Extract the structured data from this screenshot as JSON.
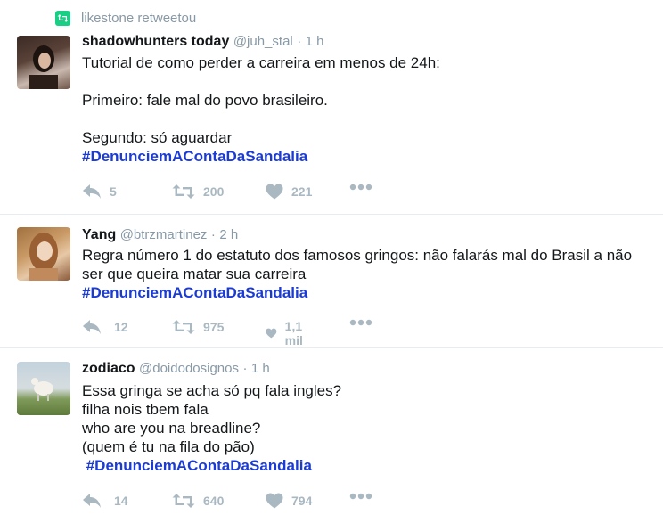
{
  "context": {
    "retweet_text": "likestone retweetou"
  },
  "tweets": [
    {
      "name": "shadowhunters today",
      "handle": "@juh_stal",
      "time": "1 h",
      "text": "Tutorial de como perder a carreira em menos de 24h:\n\nPrimeiro: fale mal do povo brasileiro.\n\nSegundo: só aguardar",
      "hashtag": "#DenunciemAContaDaSandalia",
      "replies": "5",
      "retweets": "200",
      "likes": "221"
    },
    {
      "name": "Yang",
      "handle": "@btrzmartinez",
      "time": "2 h",
      "text": "Regra número 1 do estatuto dos famosos gringos: não falarás mal do Brasil a não ser que queira matar sua carreira",
      "hashtag": "#DenunciemAContaDaSandalia",
      "replies": "12",
      "retweets": "975",
      "likes": "1,1 mil"
    },
    {
      "name": "zodiaco",
      "handle": "@doidodosignos",
      "time": "1 h",
      "text": "Essa gringa se acha só pq fala ingles?\nfilha nois tbem fala\nwho are you na breadline?\n(quem é tu na fila do pão)",
      "hashtag": " #DenunciemAContaDaSandalia",
      "replies": "14",
      "retweets": "640",
      "likes": "794"
    }
  ],
  "separator": "·",
  "colors": {
    "hashtag": "#1b3bd6",
    "muted": "#8899a6",
    "icon": "#aab8c2",
    "retweet_badge": "#19cf86"
  },
  "icons": [
    "retweet-icon",
    "reply-icon",
    "like-icon",
    "more-icon"
  ]
}
